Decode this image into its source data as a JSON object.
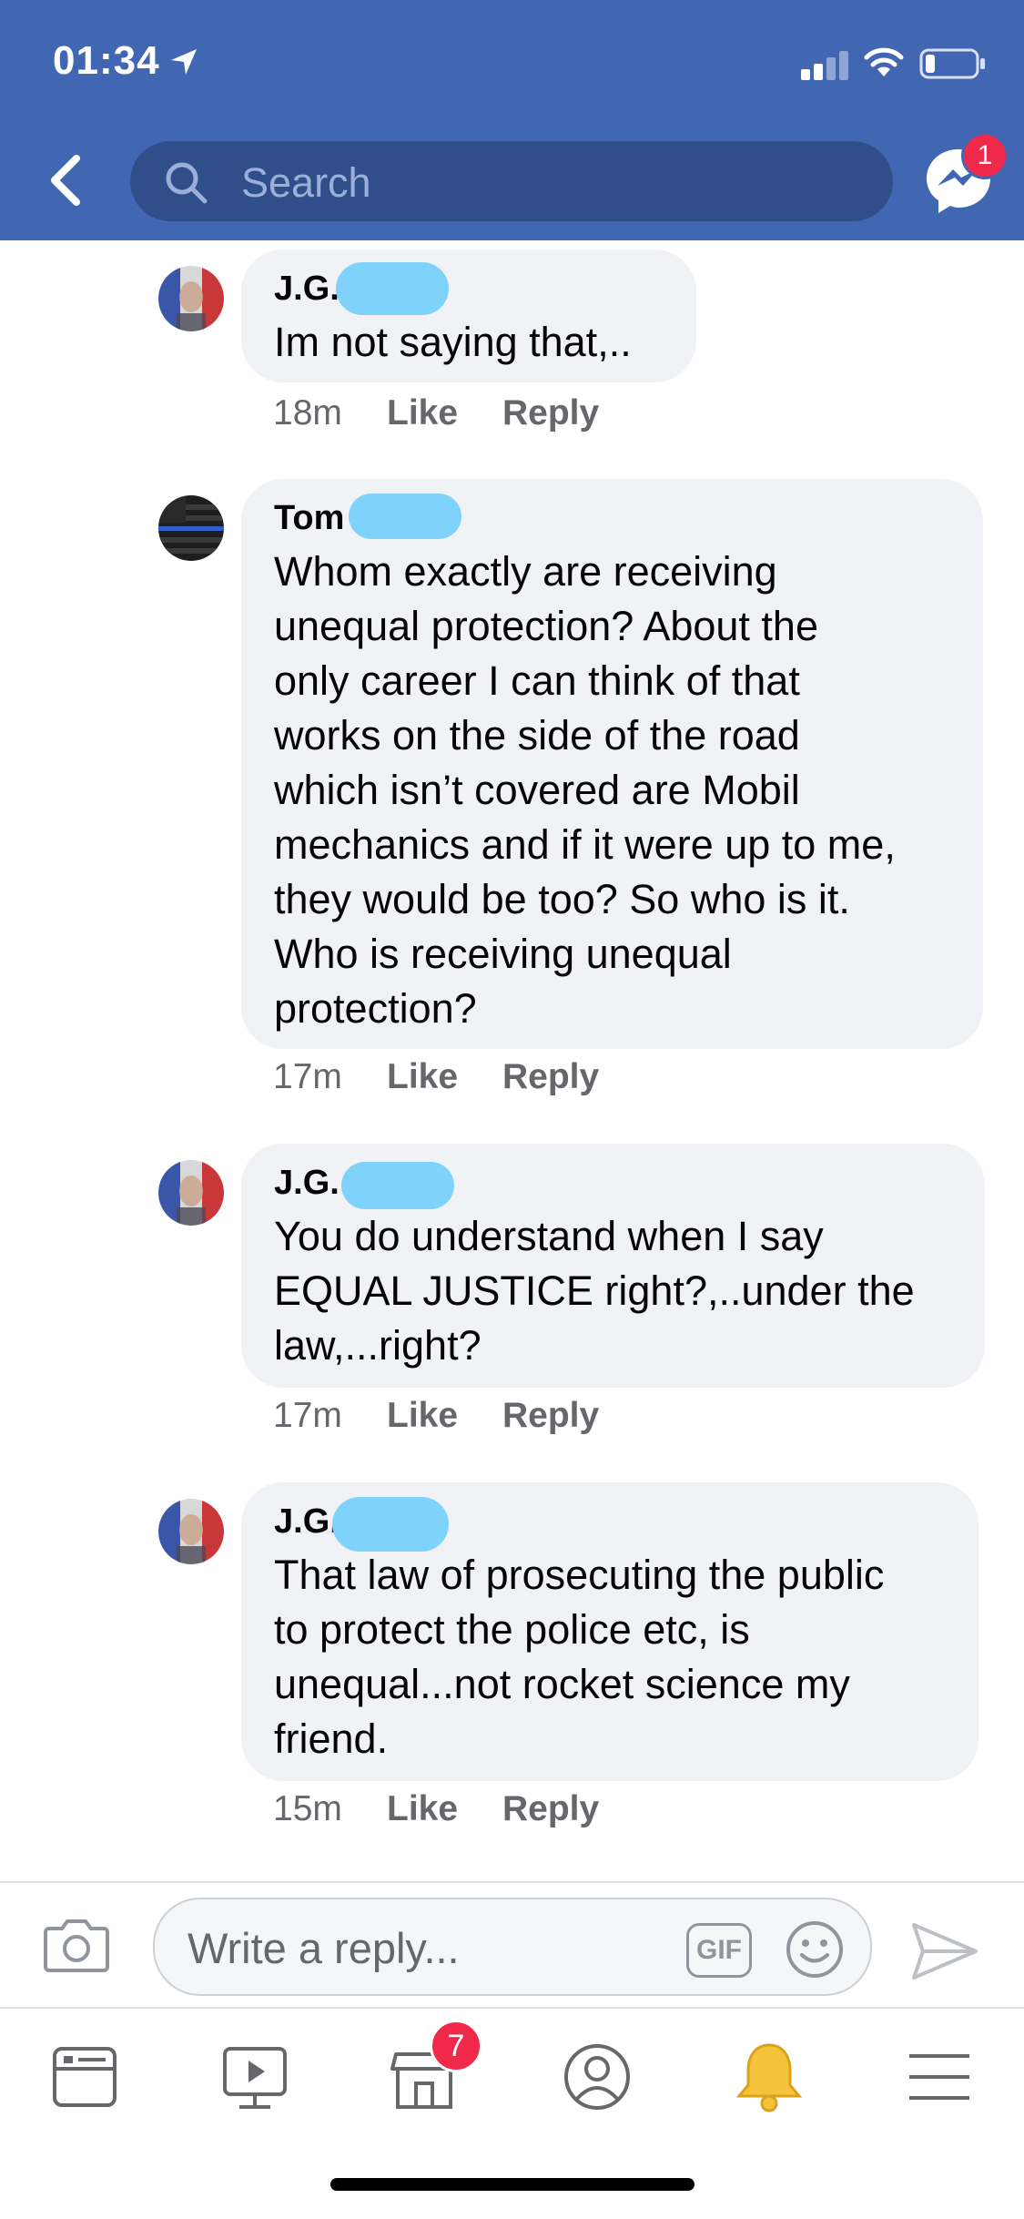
{
  "status": {
    "time": "01:34"
  },
  "header": {
    "search_placeholder": "Search",
    "messenger_badge": "1"
  },
  "comments": [
    {
      "author": "J.G.",
      "text": "Im not saying that,..",
      "time": "18m",
      "like": "Like",
      "reply": "Reply"
    },
    {
      "author": "Tom",
      "text": "Whom exactly are receiving\nunequal protection? About the\nonly career I can think of that\nworks on the side of the road\nwhich isn’t covered are Mobil\nmechanics and if it were up to me,\nthey would be too? So who is it.\nWho is receiving unequal\nprotection?",
      "time": "17m",
      "like": "Like",
      "reply": "Reply"
    },
    {
      "author": "J.G.",
      "text": "You do understand when I say\nEQUAL JUSTICE right?,..under the\nlaw,...right?",
      "time": "17m",
      "like": "Like",
      "reply": "Reply"
    },
    {
      "author": "J.G.",
      "text": "That law of prosecuting the public\nto protect the police etc, is\nunequal...not rocket science my\nfriend.",
      "time": "15m",
      "like": "Like",
      "reply": "Reply"
    }
  ],
  "composer": {
    "placeholder": "Write a reply...",
    "gif_label": "GIF"
  },
  "tabbar": {
    "marketplace_badge": "7"
  },
  "colors": {
    "header": "#4267b2",
    "bubble": "#f0f2f5",
    "badge": "#f02849",
    "redaction": "#7fd3fb"
  }
}
